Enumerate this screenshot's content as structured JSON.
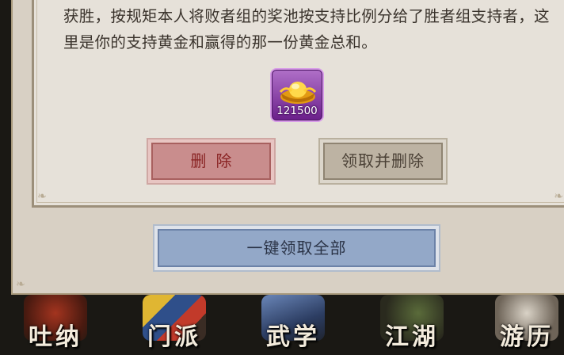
{
  "mail": {
    "message": "获胜，按规矩本人将败者组的奖池按支持比例分给了胜者组支持者，这里是你的支持黄金和赢得的那一份黄金总和。",
    "reward": {
      "icon": "gold-ingot-icon",
      "quantity": "121500"
    }
  },
  "buttons": {
    "delete": "删除",
    "claim_and_delete": "领取并删除",
    "claim_all": "一键领取全部"
  },
  "bottom_nav": {
    "tabs": [
      {
        "label": "吐纳",
        "icon": "tuna-icon"
      },
      {
        "label": "门派",
        "icon": "sect-icon"
      },
      {
        "label": "武学",
        "icon": "martial-arts-icon"
      },
      {
        "label": "江湖",
        "icon": "jianghu-icon"
      },
      {
        "label": "游历",
        "icon": "travel-icon"
      }
    ]
  },
  "colors": {
    "panel": "#e6e1d9",
    "delete_button": "#c98d8d",
    "claim_delete_button": "#bdb3a3",
    "claim_all_button": "#93a8c8",
    "reward_frame": "#8b3aa8"
  }
}
